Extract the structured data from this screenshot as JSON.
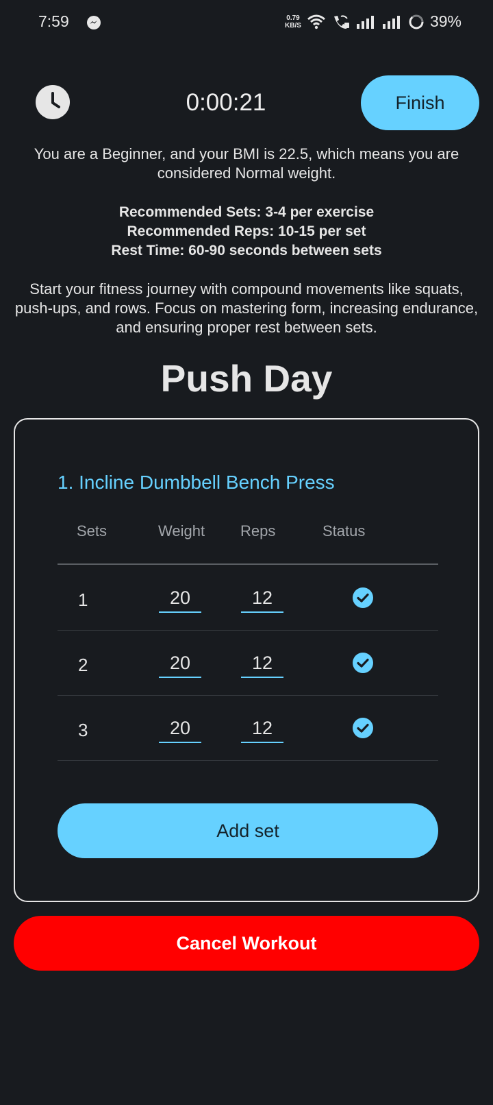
{
  "status_bar": {
    "time": "7:59",
    "net_speed_value": "0.79",
    "net_speed_unit": "KB/S",
    "battery_percent": "39%",
    "icons": [
      "messenger-icon",
      "wifi-icon",
      "wifi-call-icon",
      "signal-icon",
      "signal-icon",
      "battery-saver-icon"
    ]
  },
  "header": {
    "timer": "0:00:21",
    "finish_label": "Finish"
  },
  "intro_text": "You are a Beginner, and your BMI is 22.5, which means you are considered Normal weight.",
  "recommendations": {
    "sets": "Recommended Sets: 3-4 per exercise",
    "reps": "Recommended Reps: 10-15 per set",
    "rest": "Rest Time: 60-90 seconds between sets"
  },
  "advice_text": "Start your fitness journey with compound movements like squats, push-ups, and rows. Focus on mastering form, increasing endurance, and ensuring proper rest between sets.",
  "workout_title": "Push Day",
  "exercise": {
    "name": "1. Incline Dumbbell Bench Press",
    "columns": {
      "sets": "Sets",
      "weight": "Weight",
      "reps": "Reps",
      "status": "Status"
    },
    "rows": [
      {
        "set": "1",
        "weight": "20",
        "reps": "12",
        "status": "completed"
      },
      {
        "set": "2",
        "weight": "20",
        "reps": "12",
        "status": "completed"
      },
      {
        "set": "3",
        "weight": "20",
        "reps": "12",
        "status": "completed"
      }
    ],
    "add_set_label": "Add set"
  },
  "cancel_label": "Cancel Workout",
  "colors": {
    "background": "#181b1f",
    "accent": "#66d1ff",
    "danger": "#ff0000"
  }
}
